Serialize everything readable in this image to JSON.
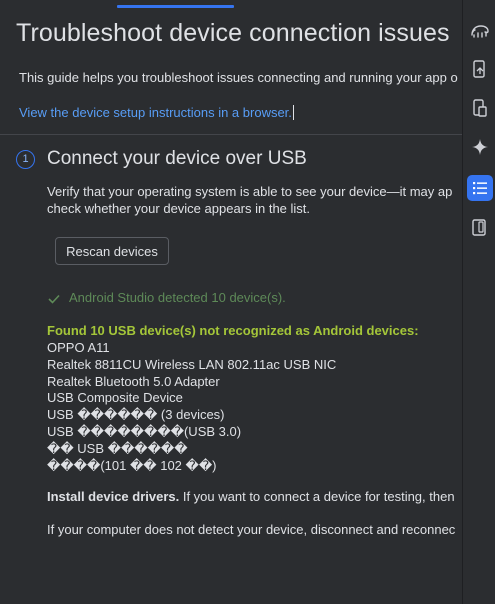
{
  "header": {
    "title": "Troubleshoot device connection issues",
    "intro": "This guide helps you troubleshoot issues connecting and running your app o",
    "browser_link": "View the device setup instructions in a browser."
  },
  "step": {
    "number": "1",
    "title": "Connect your device over USB",
    "description_line1": "Verify that your operating system is able to see your device—it may ap",
    "description_line2": "check whether your device appears in the list.",
    "rescan_label": "Rescan devices",
    "detected_text": "Android Studio detected 10 device(s).",
    "found_text": "Found 10 USB device(s) not recognized as Android devices:",
    "devices": [
      "OPPO A11",
      "Realtek 8811CU Wireless LAN 802.11ac USB NIC",
      "Realtek Bluetooth 5.0 Adapter",
      "USB Composite Device",
      "USB ������ (3 devices)",
      "USB ��������(USB 3.0)",
      "�� USB ������",
      "����(101 �� 102 ��)"
    ],
    "install_bold": "Install device drivers.",
    "install_rest": " If you want to connect a device for testing, then",
    "detect_text": "If your computer does not detect your device, disconnect and reconnec"
  },
  "sidebar": {
    "icons": [
      "gradle-elephant-icon",
      "device-mirroring-icon",
      "device-manager-icon",
      "gemini-sparkle-icon",
      "troubleshoot-list-icon",
      "running-devices-icon"
    ],
    "active": "troubleshoot-list-icon"
  },
  "colors": {
    "background": "#2b2d30",
    "accent": "#3574f0",
    "link": "#589df6",
    "success": "#5e8a58",
    "highlight": "#a4c639"
  }
}
